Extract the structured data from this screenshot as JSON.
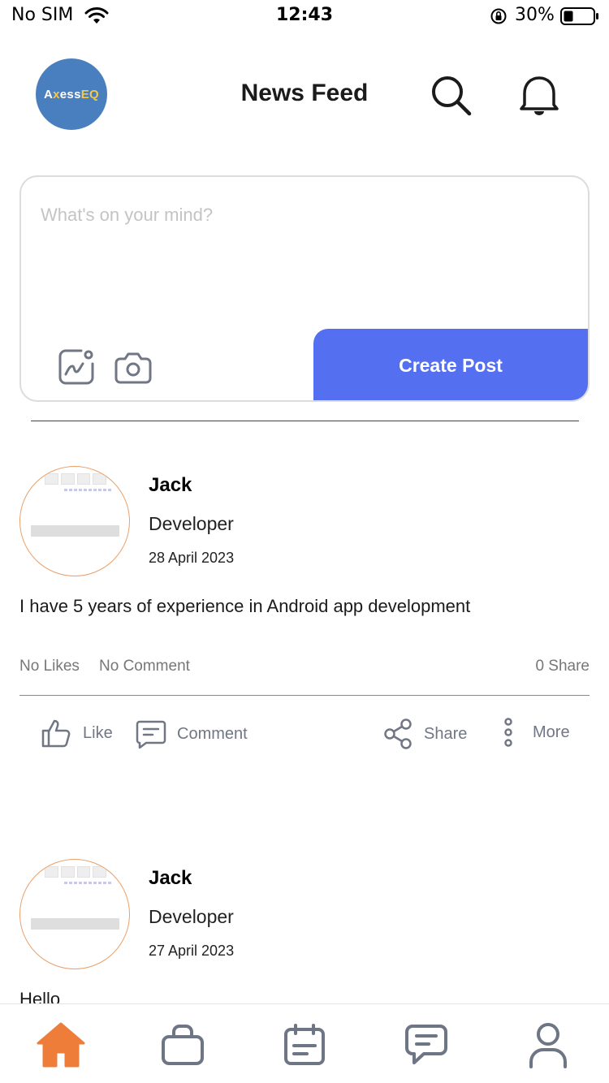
{
  "status_bar": {
    "carrier": "No SIM",
    "time": "12:43",
    "battery_percent": "30%"
  },
  "header": {
    "logo_text_a": "AxessEQ",
    "title": "News Feed",
    "search_icon": "search-icon",
    "notification_icon": "bell-icon"
  },
  "composer": {
    "placeholder": "What's on your mind?",
    "gallery_icon": "gallery-icon",
    "camera_icon": "camera-icon",
    "create_post_label": "Create Post",
    "accent_color": "#5470f0"
  },
  "posts": [
    {
      "name": "Jack",
      "role": "Developer",
      "date": "28 April 2023",
      "body": "I have 5 years of experience in Android app development",
      "likes": "No Likes",
      "comments": "No Comment",
      "shares": "0 Share",
      "actions": {
        "like": "Like",
        "comment": "Comment",
        "share": "Share",
        "more": "More"
      }
    },
    {
      "name": "Jack",
      "role": "Developer",
      "date": "27 April 2023",
      "body": "Hello"
    }
  ],
  "tab_bar": {
    "items": [
      "home-icon",
      "briefcase-icon",
      "calendar-icon",
      "chat-icon",
      "profile-icon"
    ],
    "active_index": 0,
    "active_color": "#ef7d3a",
    "inactive_color": "#6e7585"
  }
}
